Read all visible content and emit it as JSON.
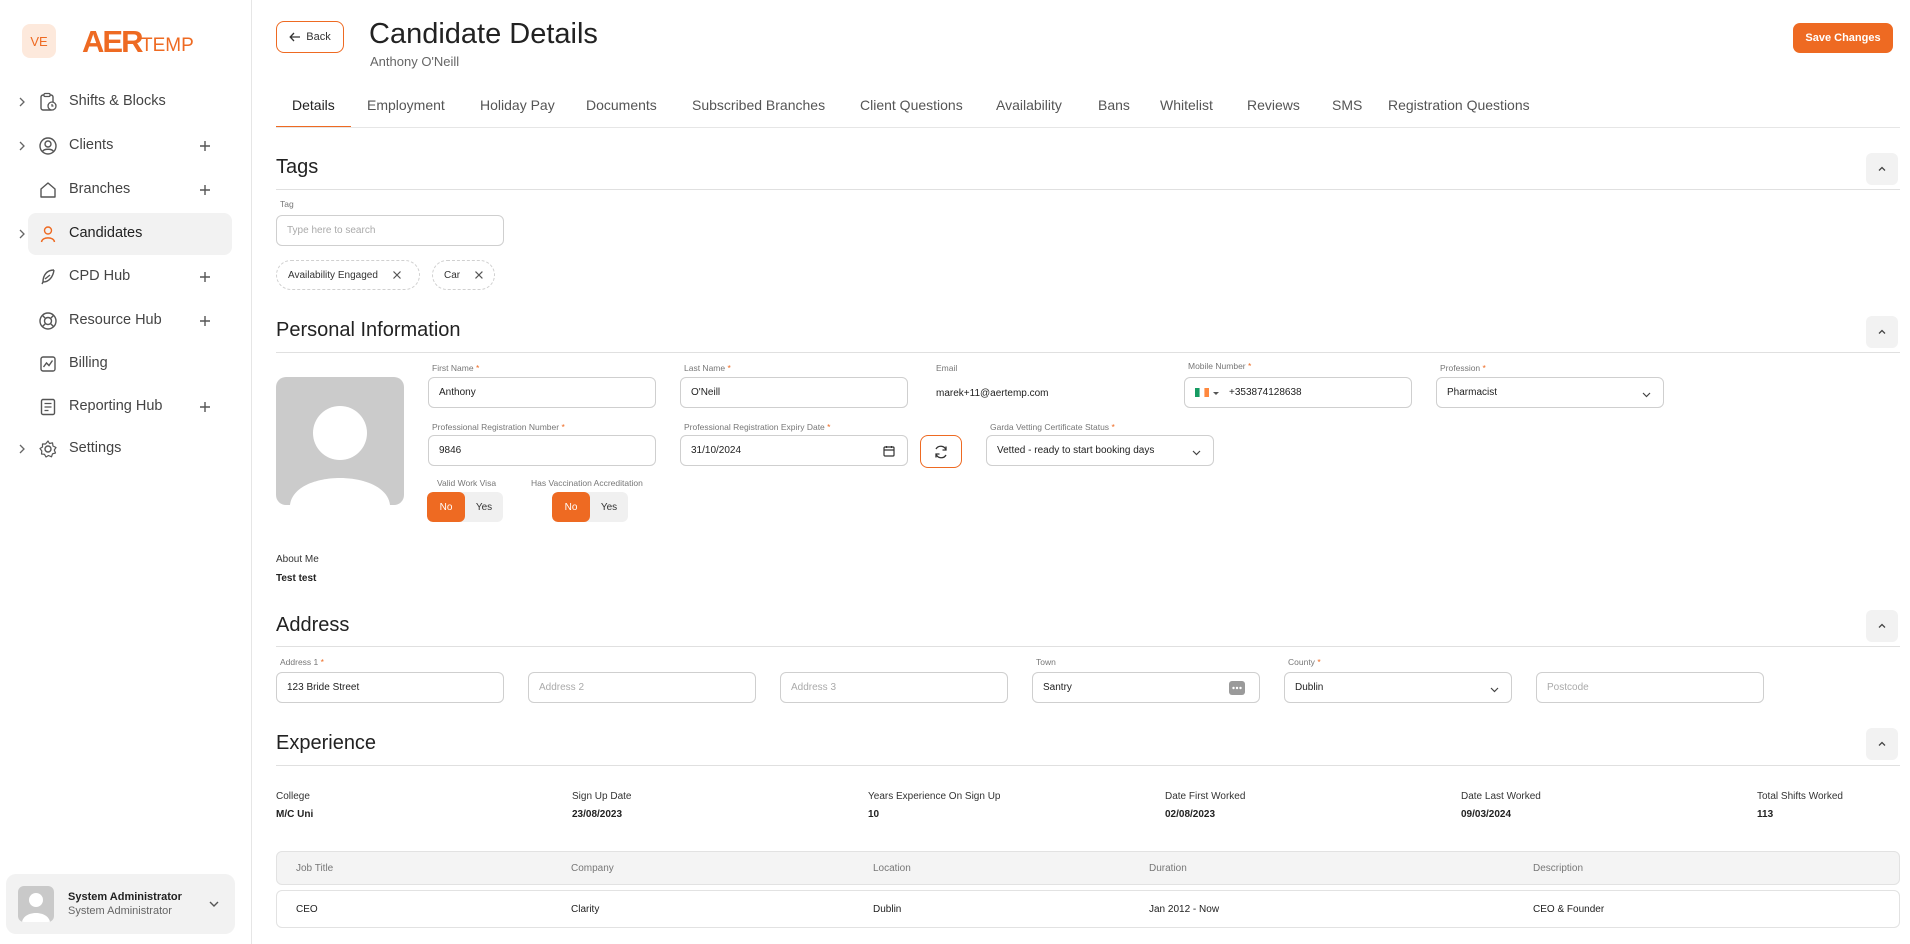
{
  "sidebar": {
    "workspace_initials": "VE",
    "logo_text": "AERTEMP",
    "items": [
      {
        "label": "Shifts & Blocks"
      },
      {
        "label": "Clients"
      },
      {
        "label": "Branches"
      },
      {
        "label": "Candidates"
      },
      {
        "label": "CPD Hub"
      },
      {
        "label": "Resource Hub"
      },
      {
        "label": "Billing"
      },
      {
        "label": "Reporting Hub"
      },
      {
        "label": "Settings"
      }
    ],
    "user": {
      "name": "System Administrator",
      "role": "System Administrator"
    }
  },
  "header": {
    "back_label": "Back",
    "title": "Candidate Details",
    "subtitle": "Anthony O'Neill",
    "save_label": "Save Changes"
  },
  "tabs": [
    {
      "label": "Details"
    },
    {
      "label": "Employment"
    },
    {
      "label": "Holiday Pay"
    },
    {
      "label": "Documents"
    },
    {
      "label": "Subscribed Branches"
    },
    {
      "label": "Client Questions"
    },
    {
      "label": "Availability"
    },
    {
      "label": "Bans"
    },
    {
      "label": "Whitelist"
    },
    {
      "label": "Reviews"
    },
    {
      "label": "SMS"
    },
    {
      "label": "Registration Questions"
    }
  ],
  "tags": {
    "title": "Tags",
    "search_label": "Tag",
    "search_placeholder": "Type here to search",
    "chips": [
      {
        "label": "Availability Engaged"
      },
      {
        "label": "Car"
      }
    ]
  },
  "personal": {
    "title": "Personal Information",
    "first_name": {
      "label": "First Name",
      "value": "Anthony"
    },
    "last_name": {
      "label": "Last Name",
      "value": "O'Neill"
    },
    "email": {
      "label": "Email",
      "value": "marek+11@aertemp.com"
    },
    "mobile": {
      "label": "Mobile Number",
      "value": "+353874128638"
    },
    "profession": {
      "label": "Profession",
      "value": "Pharmacist"
    },
    "reg_number": {
      "label": "Professional Registration Number",
      "value": "9846"
    },
    "reg_expiry": {
      "label": "Professional Registration Expiry Date",
      "value": "31/10/2024"
    },
    "garda": {
      "label": "Garda Vetting Certificate Status",
      "value": "Vetted - ready to start booking days"
    },
    "work_visa": {
      "label": "Valid Work Visa",
      "no": "No",
      "yes": "Yes",
      "selected": "No"
    },
    "vaccination": {
      "label": "Has Vaccination Accreditation",
      "no": "No",
      "yes": "Yes",
      "selected": "No"
    },
    "about_label": "About Me",
    "about_value": "Test test"
  },
  "address": {
    "title": "Address",
    "address1": {
      "label": "Address 1",
      "value": "123 Bride Street"
    },
    "address2": {
      "placeholder": "Address 2"
    },
    "address3": {
      "placeholder": "Address 3"
    },
    "town": {
      "label": "Town",
      "value": "Santry"
    },
    "county": {
      "label": "County",
      "value": "Dublin"
    },
    "postcode": {
      "placeholder": "Postcode"
    }
  },
  "experience": {
    "title": "Experience",
    "stats": [
      {
        "label": "College",
        "value": "M/C Uni"
      },
      {
        "label": "Sign Up Date",
        "value": "23/08/2023"
      },
      {
        "label": "Years Experience On Sign Up",
        "value": "10"
      },
      {
        "label": "Date First Worked",
        "value": "02/08/2023"
      },
      {
        "label": "Date Last Worked",
        "value": "09/03/2024"
      },
      {
        "label": "Total Shifts Worked",
        "value": "113"
      }
    ],
    "columns": [
      "Job Title",
      "Company",
      "Location",
      "Duration",
      "Description"
    ],
    "rows": [
      [
        "CEO",
        "Clarity",
        "Dublin",
        "Jan 2012 - Now",
        "CEO & Founder"
      ]
    ]
  },
  "colors": {
    "accent": "#ee6a22",
    "ireland_green": "#169b62",
    "ireland_orange": "#ff883e"
  }
}
